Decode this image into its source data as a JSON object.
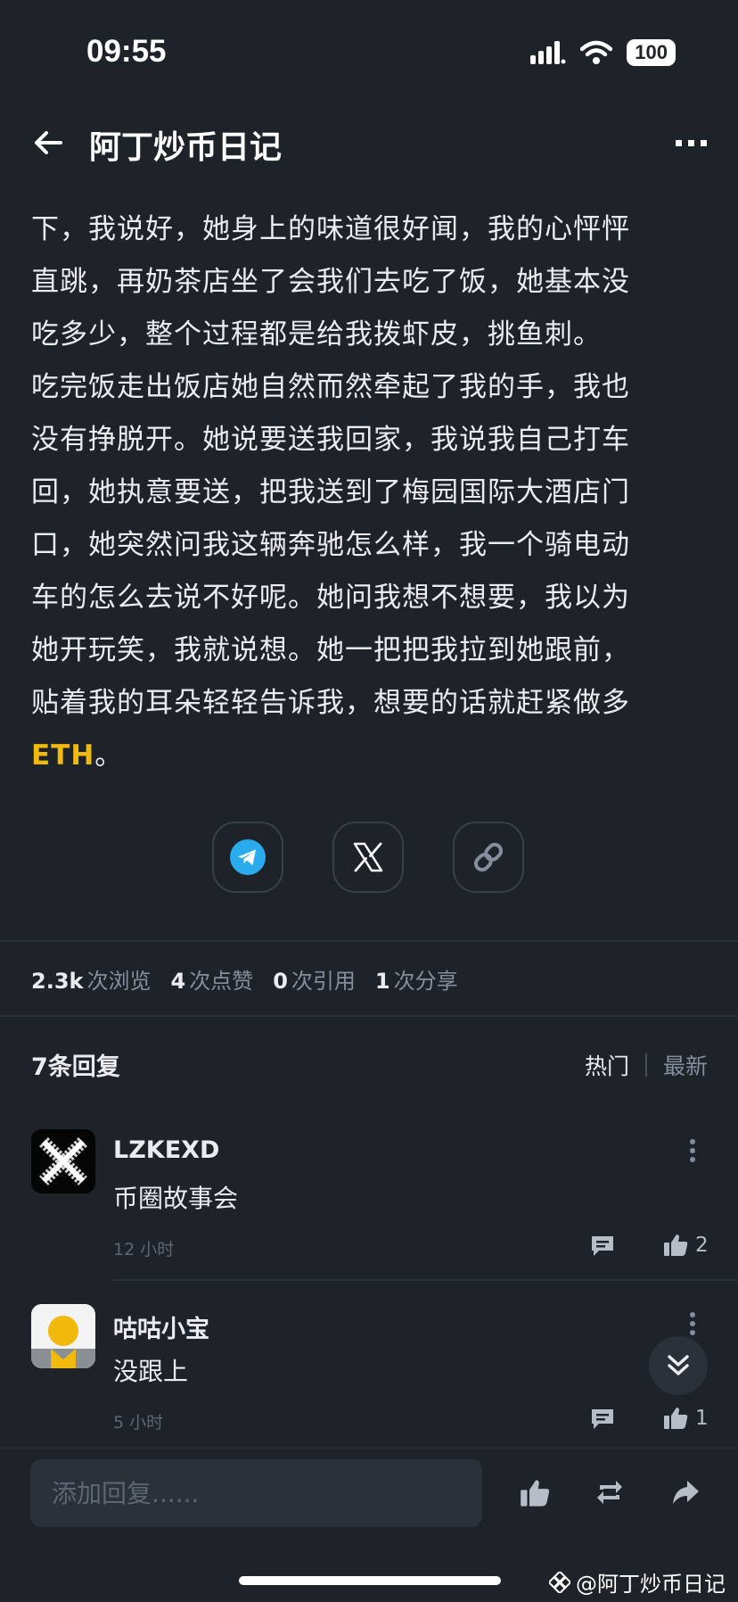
{
  "status_bar": {
    "time": "09:55",
    "battery": "100"
  },
  "header": {
    "title": "阿丁炒币日记",
    "back_icon": "arrow-left-icon",
    "more_icon": "more-horizontal-icon"
  },
  "article": {
    "lines": [
      "下，我说好，她身上的味道很好闻，我的心怦怦",
      "直跳，再奶茶店坐了会我们去吃了饭，她基本没",
      "吃多少，整个过程都是给我拨虾皮，挑鱼刺。",
      "吃完饭走出饭店她自然而然牵起了我的手，我也",
      "没有挣脱开。她说要送我回家，我说我自己打车",
      "回，她执意要送，把我送到了梅园国际大酒店门",
      "口，她突然问我这辆奔驰怎么样，我一个骑电动",
      "车的怎么去说不好呢。她问我想不想要，我以为",
      "她开玩笑，我就说想。她一把把我拉到她跟前，",
      "贴着我的耳朵轻轻告诉我，想要的话就赶紧做多"
    ],
    "last_link": "ETH",
    "last_tail": "。"
  },
  "share": {
    "icons": [
      "telegram-icon",
      "x-icon",
      "link-icon"
    ]
  },
  "stats": [
    {
      "value": "2.3k",
      "label": "次浏览"
    },
    {
      "value": "4",
      "label": "次点赞"
    },
    {
      "value": "0",
      "label": "次引用"
    },
    {
      "value": "1",
      "label": "次分享"
    }
  ],
  "replies": {
    "title": "7条回复",
    "sort_hot": "热门",
    "sort_new": "最新",
    "items": [
      {
        "user": "LZKEXD",
        "text": "币圈故事会",
        "time": "12 小时",
        "likes": "2"
      },
      {
        "user": "咕咕小宝",
        "text": "没跟上",
        "time": "5 小时",
        "likes": "1"
      }
    ]
  },
  "input": {
    "placeholder": "添加回复......"
  },
  "watermark": "@阿丁炒币日记",
  "colors": {
    "background": "#1e2329",
    "accent": "#f0b90b",
    "muted": "#848e9c"
  }
}
